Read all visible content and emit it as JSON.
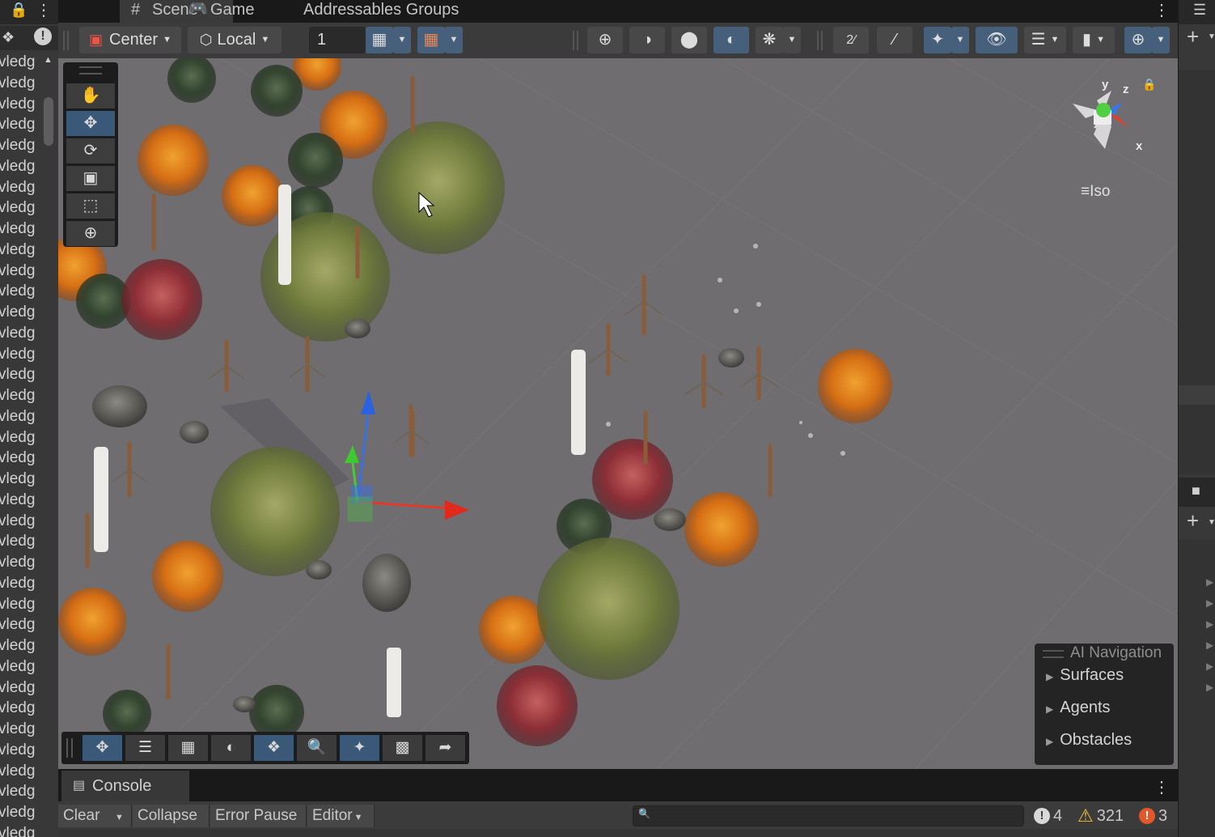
{
  "hierarchy": {
    "row_label": "vledg"
  },
  "tabs": [
    {
      "label": "Scene",
      "icon": "hash-icon"
    },
    {
      "label": "Game",
      "icon": "gamepad-icon"
    },
    {
      "label": "Addressables Groups"
    }
  ],
  "toolbar": {
    "pivot_mode": "Center",
    "pivot_rotation": "Local",
    "grid_snap_value": "1"
  },
  "scene_gizmo": {
    "y_label": "y",
    "z_label": "z",
    "x_label": "x",
    "projection": "Iso"
  },
  "ai_navigation": {
    "title": "AI Navigation",
    "items": [
      "Surfaces",
      "Agents",
      "Obstacles"
    ]
  },
  "console": {
    "tab_label": "Console",
    "clear_label": "Clear",
    "collapse_label": "Collapse",
    "error_pause_label": "Error Pause",
    "editor_label": "Editor",
    "log_count": "4",
    "warning_count": "321",
    "error_count": "3"
  },
  "colors": {
    "accent_active": "#3a5878",
    "viewport_ground": "#6f6d70",
    "error": "#e2582a",
    "warning": "#f0c030"
  }
}
